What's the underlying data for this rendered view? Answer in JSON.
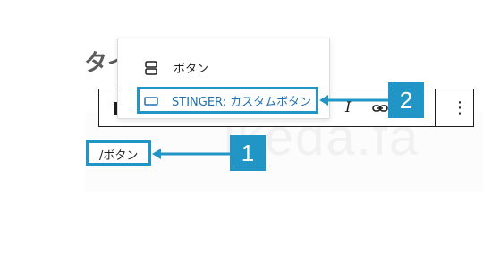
{
  "editor": {
    "title_partial": "タイ",
    "watermark_text": "ikeda.fa"
  },
  "toolbar": {
    "italic_label": "I",
    "more_icon": "⋮",
    "icons": [
      "block-type-icon",
      "italic-icon",
      "link-icon",
      "more-options-icon"
    ]
  },
  "block_menu": {
    "items": [
      {
        "label": "ボタン",
        "icon": "buttons-icon",
        "selected": false
      },
      {
        "label": "STINGER: カスタムボタン",
        "icon": "custom-button-icon",
        "selected": true
      }
    ]
  },
  "slash_command": {
    "text": "/ボタン"
  },
  "annotations": {
    "badge_1": "1",
    "badge_2": "2",
    "accent_color": "#2196c6"
  }
}
